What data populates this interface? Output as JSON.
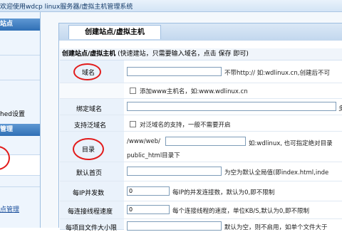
{
  "topbar": {
    "welcome": "欢迎使用wdcp linux服务器/虚拟主机管理系统"
  },
  "sidebar": {
    "header_top": "站点",
    "hed_item": "hed设置",
    "header_mgmt": "管理",
    "bottom_link": "点管理"
  },
  "tab": {
    "label": "创建站点/虚拟主机"
  },
  "form": {
    "title": "创建站点/虚拟主机",
    "hint": "(快速建站，只需要输入域名，点击 保存 即可)",
    "rows": [
      {
        "label": "域名",
        "note": "不带http:// 如:wdlinux.cn,创建后不可"
      },
      {
        "checkbox_text": "添加www主机名，如:www.wdlinux.cn"
      },
      {
        "label": "绑定域名",
        "note": "多"
      },
      {
        "label": "支持泛域名",
        "checkbox_text": "对泛域名的支持，一般不需要开启"
      },
      {
        "label": "目录",
        "prefix": "/www/web/",
        "note": "如:wdlinux, 也可指定绝对目录",
        "note2": "public_html目录下"
      },
      {
        "label": "默认首页",
        "note": "为空为默认全局值(即index.html,inde"
      },
      {
        "label": "每IP并发数",
        "value": "0",
        "note": "每IP的并发连接数，默认为0,即不限制"
      },
      {
        "label": "每连接线程速度",
        "value": "0",
        "note": "每个连接线程的速度，单位KB/S,默认为0,即不限制"
      },
      {
        "label": "每项目文件大小限",
        "note": "默认为空，则不启用，如单个文件大于"
      }
    ]
  },
  "colors": {
    "annotation": "#e21b1b",
    "header_blue": "#2f6fb5"
  }
}
